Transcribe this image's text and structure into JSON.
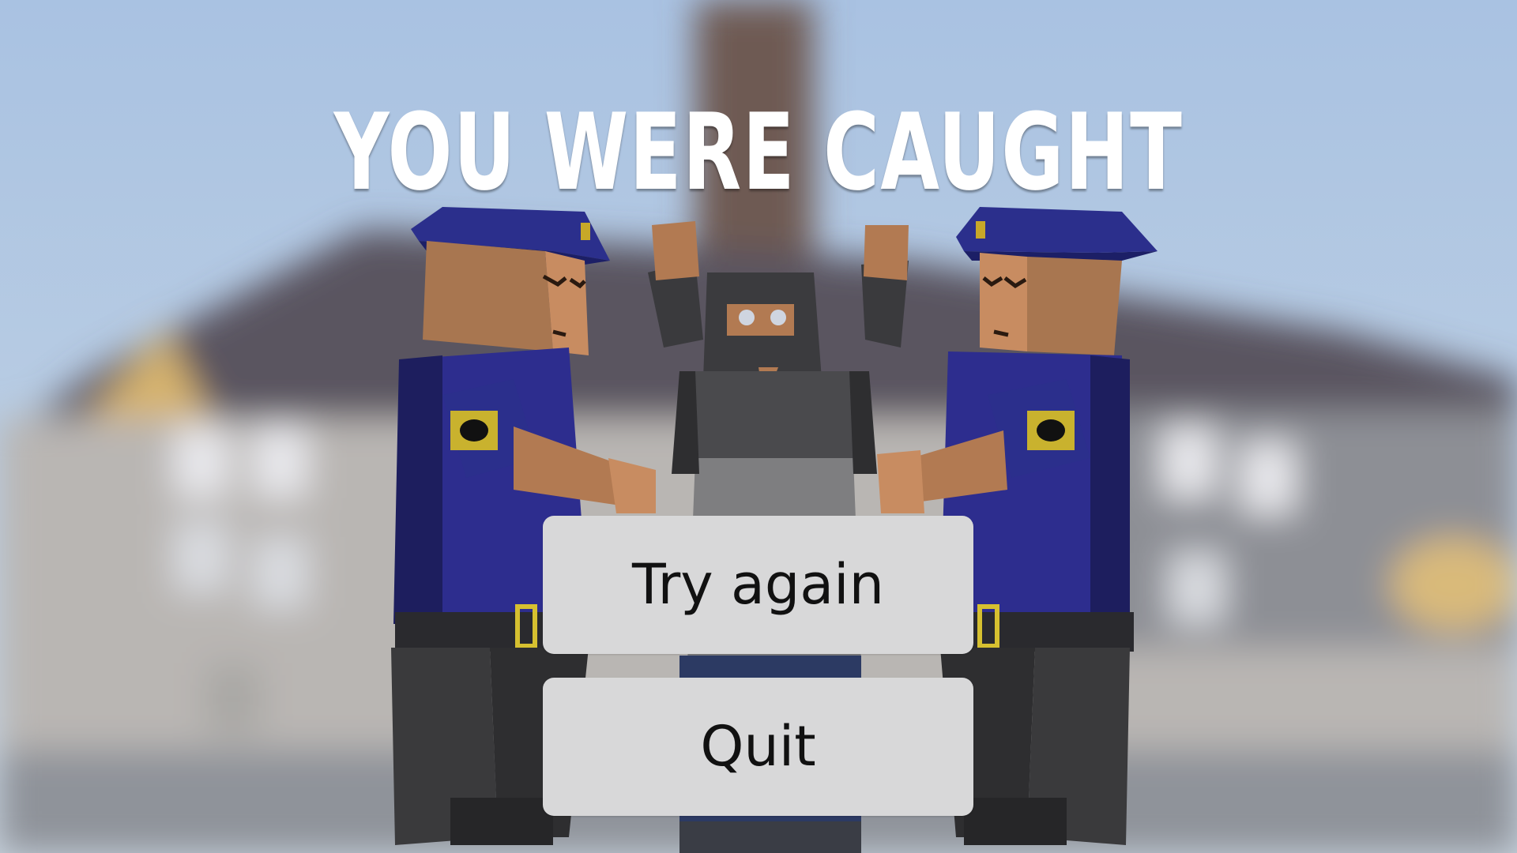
{
  "screen": {
    "title": "YOU WERE CAUGHT",
    "scene_description_icons": [
      "police-officer-left",
      "caught-thief",
      "police-officer-right",
      "blurred-town-building"
    ]
  },
  "menu": {
    "try_again_label": "Try again",
    "quit_label": "Quit"
  },
  "colors": {
    "sky": "#aec6e3",
    "button_bg": "#d8d8d9",
    "button_text": "#111111",
    "title": "#ffffff",
    "uniform": "#2a2a90",
    "skin": "#b77a55"
  }
}
